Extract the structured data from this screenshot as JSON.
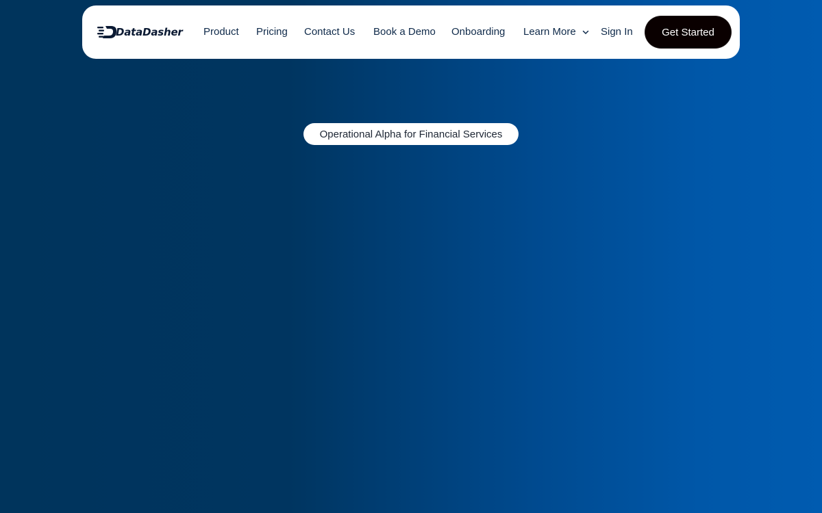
{
  "brand": {
    "name": "DataDasher",
    "logo_icon": "speed-lines-d-icon"
  },
  "nav": {
    "items": [
      {
        "label": "Product"
      },
      {
        "label": "Pricing"
      },
      {
        "label": "Contact Us"
      },
      {
        "label": "Book a Demo"
      },
      {
        "label": "Onboarding"
      },
      {
        "label": "Learn More",
        "icon": "chevron-down-icon"
      }
    ],
    "sign_in": "Sign In",
    "cta": "Get Started"
  },
  "hero": {
    "badge": "Operational Alpha for Financial Services"
  },
  "colors": {
    "background_start": "#00345c",
    "background_end": "#005bb0",
    "cta_bg": "#0a0000",
    "nav_text": "#0f2a4a"
  }
}
